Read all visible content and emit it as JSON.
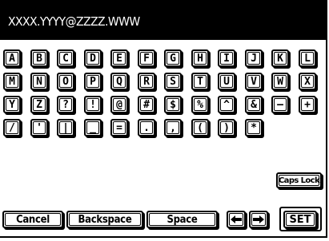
{
  "header": {
    "input_text": "XXXX.YYYY@ZZZZ.WWW"
  },
  "rows": [
    [
      "A",
      "B",
      "C",
      "D",
      "E",
      "F",
      "G",
      "H",
      "I",
      "J",
      "K",
      "L"
    ],
    [
      "M",
      "N",
      "O",
      "P",
      "Q",
      "R",
      "S",
      "T",
      "U",
      "V",
      "W",
      "X"
    ],
    [
      "Y",
      "Z",
      "?",
      "!",
      "@",
      "#",
      "$",
      "%",
      "^",
      "&",
      "—",
      "+"
    ],
    [
      "/",
      "'",
      "|",
      "_",
      "=",
      ".",
      ",",
      "(",
      ")",
      "*"
    ]
  ],
  "caps_lock_label": "Caps Lock",
  "bottom": {
    "cancel_label": "Cancel",
    "backspace_label": "Backspace",
    "space_label": "Space",
    "left_arrow_icon": "arrow-left-icon",
    "right_arrow_icon": "arrow-right-icon",
    "set_label": "SET"
  }
}
